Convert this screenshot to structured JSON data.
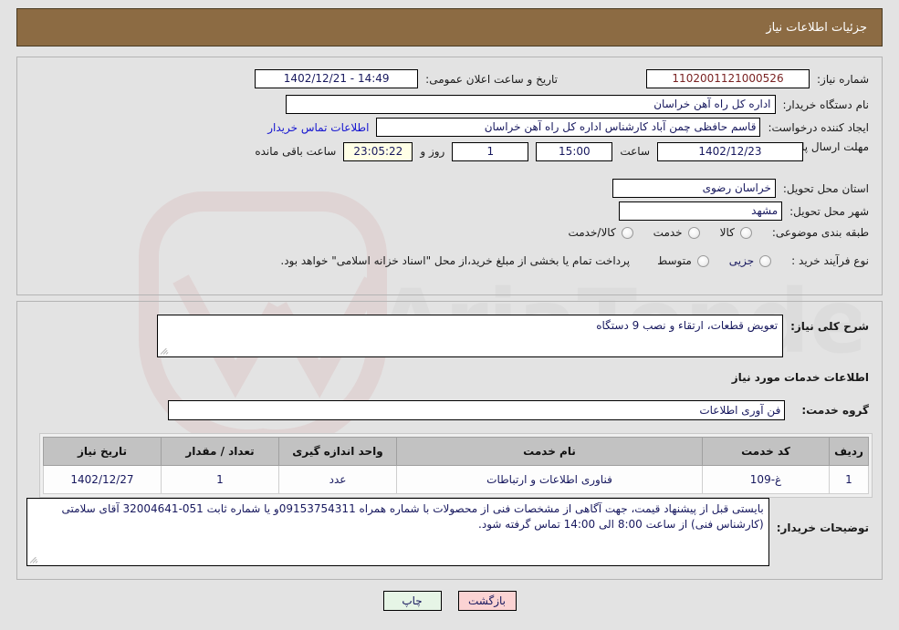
{
  "header": {
    "title": "جزئیات اطلاعات نیاز",
    "bg": "#8c6b43"
  },
  "top_form": {
    "need_number": {
      "label": "شماره نیاز:",
      "value": "1102001121000526"
    },
    "public_announce": {
      "label": "تاریخ و ساعت اعلان عمومی:",
      "value": "14:49 - 1402/12/21"
    },
    "buyer_org": {
      "label": "نام دستگاه خریدار:",
      "value": "اداره کل راه آهن خراسان"
    },
    "requester": {
      "label": "ایجاد کننده درخواست:",
      "value": "قاسم حافظی چمن آباد کارشناس اداره کل راه آهن خراسان"
    },
    "contact_link": "اطلاعات تماس خریدار",
    "deadline": {
      "label": "مهلت ارسال پاسخ: تا تاریخ:",
      "date": "1402/12/23",
      "hour_label": "ساعت",
      "hour": "15:00",
      "days": "1",
      "days_label": "روز و",
      "countdown": "23:05:22",
      "countdown_label": "ساعت باقی مانده"
    },
    "province": {
      "label": "استان محل تحویل:",
      "value": "خراسان رضوی"
    },
    "city": {
      "label": "شهر محل تحویل:",
      "value": "مشهد"
    },
    "category": {
      "label": "طبقه بندی موضوعی:",
      "options": [
        {
          "label": "کالا",
          "selected": false
        },
        {
          "label": "خدمت",
          "selected": false
        },
        {
          "label": "کالا/خدمت",
          "selected": false
        }
      ]
    },
    "purchase_type": {
      "label": "نوع فرآیند خرید :",
      "options": [
        {
          "label": "جزیی",
          "selected": false
        },
        {
          "label": "متوسط",
          "selected": false
        }
      ],
      "note": "پرداخت تمام یا بخشی از مبلغ خرید،از محل \"اسناد خزانه اسلامی\" خواهد بود."
    }
  },
  "bottom": {
    "general_desc": {
      "label": "شرح کلی نیاز:",
      "value": "تعویض قطعات، ارتقاء و نصب 9 دستگاه"
    },
    "services_heading": "اطلاعات خدمات مورد نیاز",
    "service_group": {
      "label": "گروه خدمت:",
      "value": "فن آوری اطلاعات"
    },
    "table": {
      "columns": [
        "ردیف",
        "کد خدمت",
        "نام خدمت",
        "واحد اندازه گیری",
        "تعداد / مقدار",
        "تاریخ نیاز"
      ],
      "rows": [
        [
          "1",
          "غ-109",
          "فناوری اطلاعات و ارتباطات",
          "عدد",
          "1",
          "1402/12/27"
        ]
      ]
    },
    "buyer_notes": {
      "label": "توضیحات خریدار:",
      "value": "بایستی قبل از پیشنهاد قیمت، جهت آگاهی از مشخصات فنی از محصولات با شماره همراه 09153754311و یا شماره ثابت 051-32004641 آقای سلامتی (کارشناس فنی) از ساعت 8:00  الی 14:00  تماس گرفته شود."
    }
  },
  "buttons": {
    "print": "چاپ",
    "back": "بازگشت"
  },
  "watermark": {
    "text": "AriaTender.net"
  }
}
